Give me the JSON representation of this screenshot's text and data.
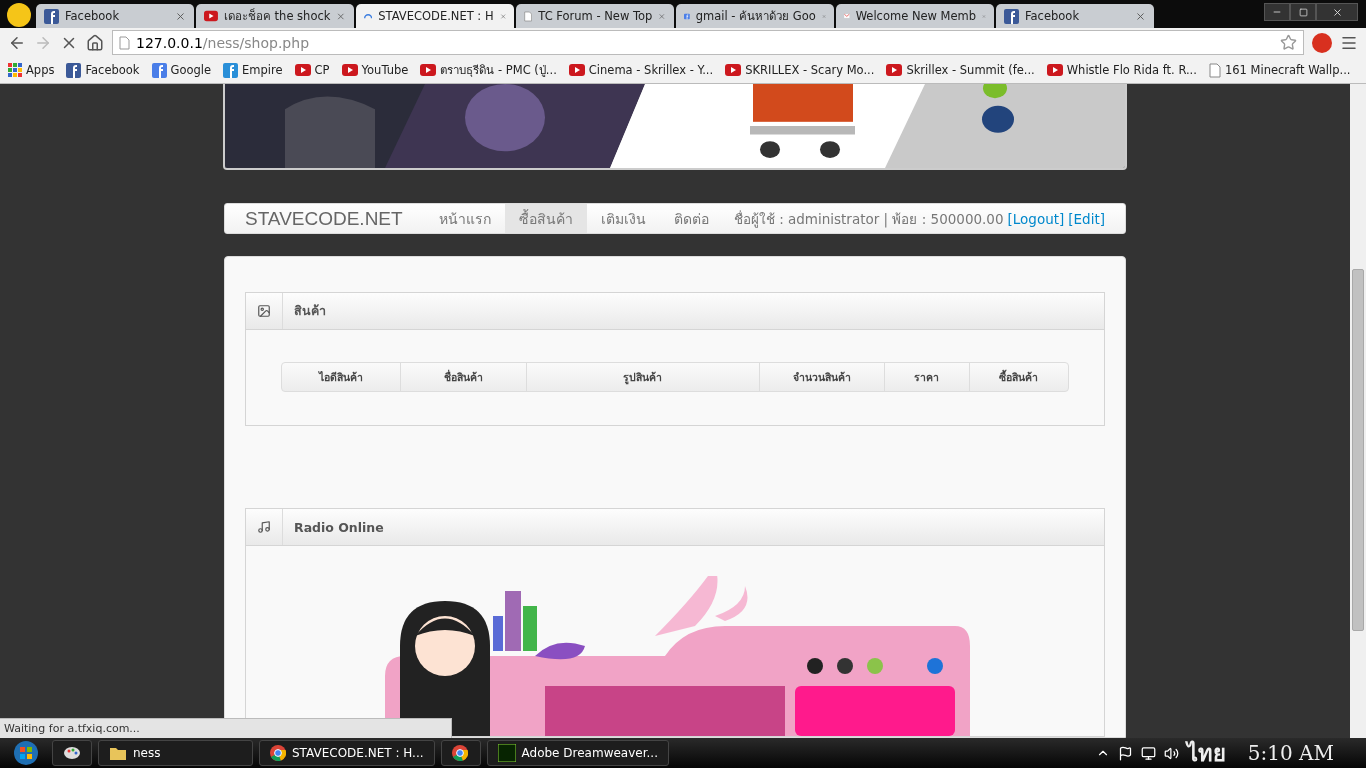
{
  "browser": {
    "tabs": [
      {
        "title": "Facebook",
        "kind": "facebook",
        "selected": false
      },
      {
        "title": "เดอะช็อค the shock",
        "kind": "youtube",
        "selected": false
      },
      {
        "title": "STAVECODE.NET : H",
        "kind": "loading",
        "selected": true
      },
      {
        "title": "TC Forum - New Top",
        "kind": "page",
        "selected": false
      },
      {
        "title": "gmail - ค้นหาด้วย Goo",
        "kind": "google",
        "selected": false
      },
      {
        "title": "Welcome New Memb",
        "kind": "gmail",
        "selected": false
      },
      {
        "title": "Facebook",
        "kind": "facebook",
        "selected": false
      }
    ],
    "url_host": "127.0.0.1",
    "url_path": "/ness/shop.php",
    "bookmarks": [
      {
        "title": "Apps",
        "kind": "apps"
      },
      {
        "title": "Facebook",
        "kind": "facebook"
      },
      {
        "title": "Google",
        "kind": "google"
      },
      {
        "title": "Empire",
        "kind": "empire"
      },
      {
        "title": "CP",
        "kind": "youtube"
      },
      {
        "title": "YouTube",
        "kind": "youtube"
      },
      {
        "title": "ตราบธุรีดิน - PMC (ปู่...",
        "kind": "youtube"
      },
      {
        "title": "Cinema - Skrillex - Y...",
        "kind": "youtube"
      },
      {
        "title": "SKRILLEX - Scary Mo...",
        "kind": "youtube"
      },
      {
        "title": "Skrillex - Summit (fe...",
        "kind": "youtube"
      },
      {
        "title": "Whistle Flo Rida ft. R...",
        "kind": "youtube"
      },
      {
        "title": "161 Minecraft Wallp...",
        "kind": "wiki"
      }
    ]
  },
  "page": {
    "navbar": {
      "brand": "STAVECODE.NET",
      "items": [
        {
          "label": "หน้าแรก",
          "selected": false
        },
        {
          "label": "ซื้อสินค้า",
          "selected": true
        },
        {
          "label": "เติมเงิน",
          "selected": false
        },
        {
          "label": "ติดต่อ",
          "selected": false
        }
      ],
      "user_info": "ชื่อผู้ใช้ : administrator | พ้อย : 500000.00",
      "links": [
        "[Logout]",
        "[Edit]"
      ]
    },
    "products_panel": {
      "title": "สินค้า",
      "columns": [
        "ไอดีสินค้า",
        "ชื่อสินค้า",
        "รูปสินค้า",
        "จำนวนสินค้า",
        "ราคา",
        "ซื้อสินค้า"
      ]
    },
    "radio_panel": {
      "title": "Radio Online"
    }
  },
  "status_text": "Waiting for a.tfxiq.com...",
  "taskbar": {
    "items": [
      {
        "kind": "paint"
      },
      {
        "label": "ness",
        "kind": "folder"
      },
      {
        "label": "STAVECODE.NET : H...",
        "kind": "chrome"
      },
      {
        "kind": "chrome"
      },
      {
        "label": "Adobe Dreamweaver...",
        "kind": "dreamweaver"
      }
    ],
    "language": "ไทย",
    "clock": "5:10 AM"
  }
}
